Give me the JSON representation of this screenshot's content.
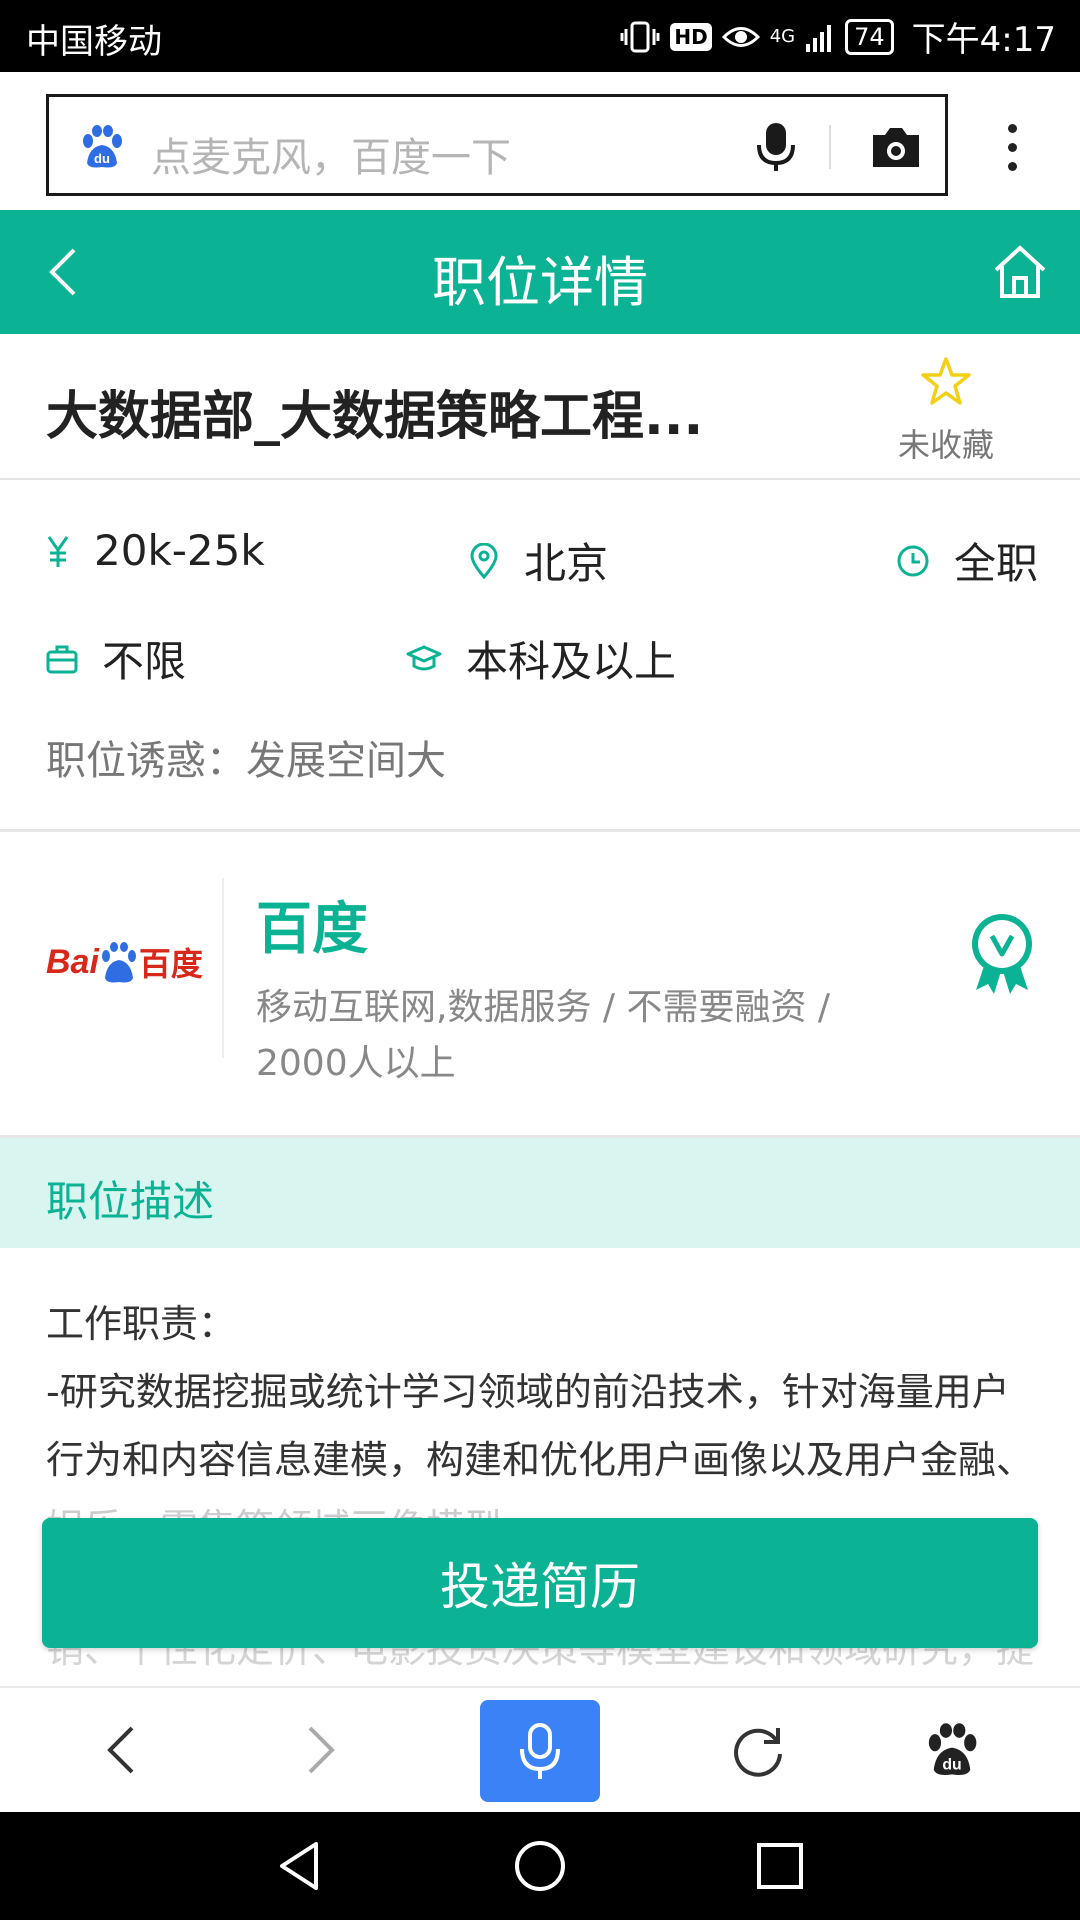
{
  "status_bar": {
    "carrier": "中国移动",
    "hd": "HD",
    "network": "4G",
    "battery": "74",
    "time": "下午4:17"
  },
  "browser": {
    "search_placeholder": "点麦克风，百度一下"
  },
  "header": {
    "title": "职位详情"
  },
  "job": {
    "title": "大数据部_大数据策略工程...",
    "favorite_label": "未收藏",
    "salary": "20k-25k",
    "city": "北京",
    "job_type": "全职",
    "experience": "不限",
    "education": "本科及以上",
    "perk": "职位诱惑：发展空间大"
  },
  "company": {
    "logo_text_latin": "Bai",
    "logo_text_cn": "百度",
    "name": "百度",
    "meta": "移动互联网,数据服务 / 不需要融资 / 2000人以上"
  },
  "description": {
    "section_title": "职位描述",
    "heading": "工作职责：",
    "line1": "-研究数据挖掘或统计学习领域的前沿技术，针对海量用户",
    "line2": "行为和内容信息建模，构建和优化用户画像以及用户金融、",
    "line3": "娱乐、零售等领域画像模型",
    "tail": "销、个性化定价、电影投资决策等模型建设和领域研究，提"
  },
  "apply_button": "投递简历",
  "colors": {
    "brand_green": "#0bb394",
    "description_bg": "#d9f5ef",
    "voice_blue": "#3b82f6"
  }
}
